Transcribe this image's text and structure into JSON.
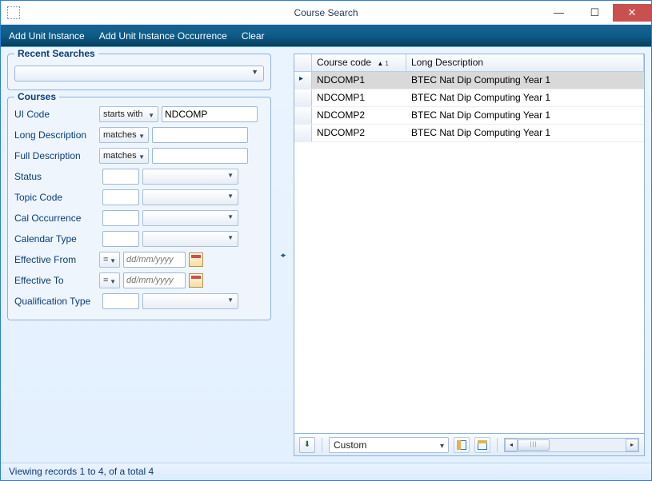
{
  "titlebar": {
    "title": "Course Search"
  },
  "menu": {
    "add_unit_instance": "Add Unit Instance",
    "add_unit_instance_occurrence": "Add Unit Instance Occurrence",
    "clear": "Clear"
  },
  "recent_searches": {
    "title": "Recent Searches"
  },
  "courses": {
    "title": "Courses",
    "fields": {
      "ui_code": {
        "label": "UI Code",
        "op": "starts with",
        "value": "NDCOMP"
      },
      "long_description": {
        "label": "Long Description",
        "op": "matches",
        "value": ""
      },
      "full_description": {
        "label": "Full Description",
        "op": "matches",
        "value": ""
      },
      "status": {
        "label": "Status",
        "value": ""
      },
      "topic_code": {
        "label": "Topic Code",
        "value": ""
      },
      "cal_occurrence": {
        "label": "Cal Occurrence",
        "value": ""
      },
      "calendar_type": {
        "label": "Calendar Type",
        "value": ""
      },
      "effective_from": {
        "label": "Effective From",
        "op": "=",
        "placeholder": "dd/mm/yyyy"
      },
      "effective_to": {
        "label": "Effective To",
        "op": "=",
        "placeholder": "dd/mm/yyyy"
      },
      "qualification_type": {
        "label": "Qualification Type",
        "value": ""
      }
    }
  },
  "grid": {
    "columns": {
      "course_code": "Course code",
      "long_description": "Long Description"
    },
    "sort_indicator": "▲",
    "sort_order": "1",
    "rows": [
      {
        "course_code": "NDCOMP1",
        "long_description": "BTEC Nat Dip Computing Year 1"
      },
      {
        "course_code": "NDCOMP1",
        "long_description": "BTEC Nat Dip Computing Year 1"
      },
      {
        "course_code": "NDCOMP2",
        "long_description": "BTEC Nat Dip Computing Year 1"
      },
      {
        "course_code": "NDCOMP2",
        "long_description": "BTEC Nat Dip Computing Year 1"
      }
    ]
  },
  "bottom": {
    "filter_label": "Custom"
  },
  "status": {
    "text": "Viewing records 1 to 4, of a total 4"
  }
}
